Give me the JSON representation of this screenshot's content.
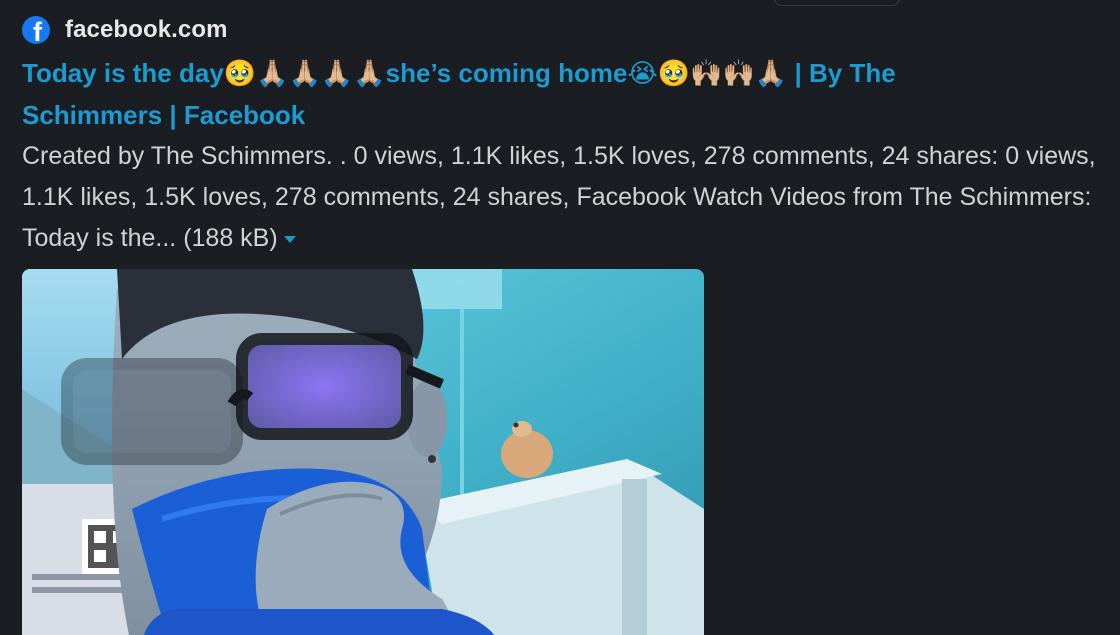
{
  "unfurl": {
    "source": {
      "icon": "facebook-icon",
      "icon_glyph": "f",
      "name": "facebook.com",
      "brand_color": "#1877f2"
    },
    "title": "Today is the day🥹🙏🏼🙏🏼🙏🏼🙏🏼she’s coming home😭🥹🙌🏼🙌🏼🙏🏼 | By The Schimmers | Facebook",
    "description": "Created by The Schimmers. . 0 views, 1.1K likes, 1.5K loves, 278 comments, 24 shares: 0 views, 1.1K likes, 1.5K loves, 278 comments, 24 shares, Facebook Watch Videos from The Schimmers: Today is the... (188 kB)",
    "expand_icon": "caret-down-icon",
    "link_color": "#1d9bd1",
    "background_color": "#1a1d21"
  }
}
